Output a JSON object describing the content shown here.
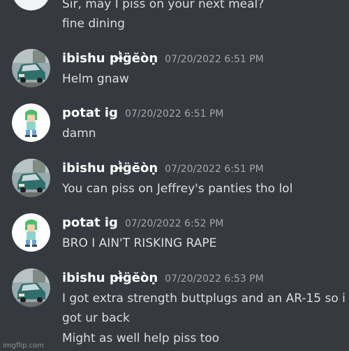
{
  "messages": [
    {
      "id": "m0",
      "continuation_lines": [
        "Sir, may I piss on your next meal?",
        "fine dining"
      ]
    },
    {
      "id": "m1",
      "username": "ibishu pi̴͗g̈ĕòṇ",
      "timestamp": "07/20/2022 6:51 PM",
      "lines": [
        "Helm gnaw"
      ],
      "avatar": "car-avatar"
    },
    {
      "id": "m2",
      "username": "potat ig",
      "timestamp": "07/20/2022 6:51 PM",
      "lines": [
        "damn"
      ],
      "avatar": "character-avatar"
    },
    {
      "id": "m3",
      "username": "ibishu pi̴͗g̈ĕòṇ",
      "timestamp": "07/20/2022 6:51 PM",
      "lines": [
        "You can piss on Jeffrey's panties tho lol"
      ],
      "avatar": "car-avatar"
    },
    {
      "id": "m4",
      "username": "potat ig",
      "timestamp": "07/20/2022 6:52 PM",
      "lines": [
        "BRO I AIN'T RISKING RAPE"
      ],
      "avatar": "character-avatar"
    },
    {
      "id": "m5",
      "username": "ibishu pi̴͗g̈ĕòṇ",
      "timestamp": "07/20/2022 6:53 PM",
      "lines": [
        "I got extra strength buttplugs and an AR-15 so i",
        "got ur back",
        "Might as well help piss too"
      ],
      "avatar": "car-avatar"
    }
  ],
  "watermark": "imgflip.com",
  "colors": {
    "background": "#36393f",
    "username": "#ffffff",
    "timestamp": "#a3a6aa",
    "message_text": "#dcddde"
  }
}
